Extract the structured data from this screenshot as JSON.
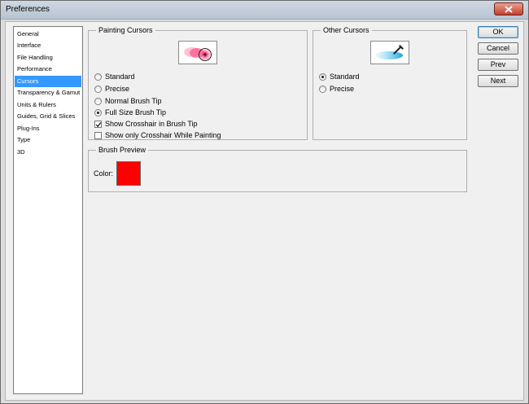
{
  "window": {
    "title": "Preferences"
  },
  "sidebar": {
    "items": [
      {
        "label": "General"
      },
      {
        "label": "Interface"
      },
      {
        "label": "File Handling"
      },
      {
        "label": "Performance"
      },
      {
        "label": "Cursors",
        "selected": true
      },
      {
        "label": "Transparency & Gamut"
      },
      {
        "label": "Units & Rulers"
      },
      {
        "label": "Guides, Grid & Slices"
      },
      {
        "label": "Plug-Ins"
      },
      {
        "label": "Type"
      },
      {
        "label": "3D"
      }
    ]
  },
  "painting_cursors": {
    "legend": "Painting Cursors",
    "preview_icon": "brush-tip-cursor-icon",
    "options": [
      {
        "label": "Standard",
        "checked": false
      },
      {
        "label": "Precise",
        "checked": false
      },
      {
        "label": "Normal Brush Tip",
        "checked": false
      },
      {
        "label": "Full Size Brush Tip",
        "checked": true
      }
    ],
    "checkboxes": [
      {
        "label": "Show Crosshair in Brush Tip",
        "checked": true
      },
      {
        "label": "Show only Crosshair While Painting",
        "checked": false
      }
    ]
  },
  "other_cursors": {
    "legend": "Other Cursors",
    "preview_icon": "eyedropper-cursor-icon",
    "options": [
      {
        "label": "Standard",
        "checked": true
      },
      {
        "label": "Precise",
        "checked": false
      }
    ]
  },
  "brush_preview": {
    "legend": "Brush Preview",
    "color_label": "Color:",
    "color": "#ff0000"
  },
  "buttons": {
    "ok": "OK",
    "cancel": "Cancel",
    "prev": "Prev",
    "next": "Next"
  }
}
